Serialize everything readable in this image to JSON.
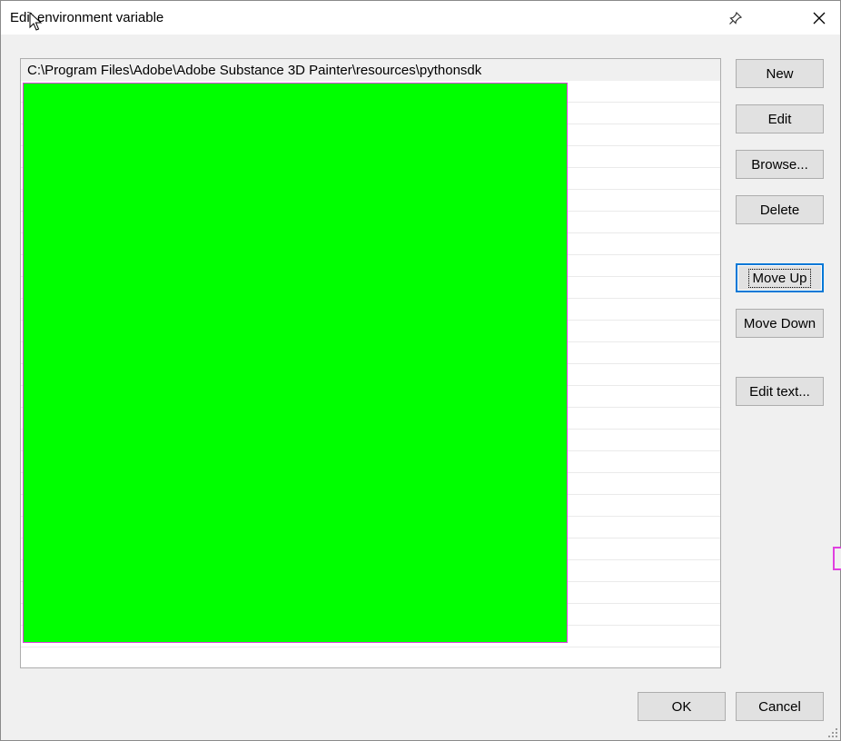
{
  "window": {
    "title": "Edit environment variable"
  },
  "list": {
    "items": [
      "C:\\Program Files\\Adobe\\Adobe Substance 3D Painter\\resources\\pythonsdk"
    ],
    "empty_rows": 26
  },
  "buttons": {
    "new": "New",
    "edit": "Edit",
    "browse": "Browse...",
    "delete": "Delete",
    "move_up": "Move Up",
    "move_down": "Move Down",
    "edit_text": "Edit text...",
    "ok": "OK",
    "cancel": "Cancel"
  },
  "icons": {
    "pin": "pin-icon",
    "close": "close-icon",
    "cursor": "mouse-cursor-icon",
    "resize": "resize-grip-icon"
  },
  "colors": {
    "focus": "#0078d7",
    "overlay_fill": "#00ff00",
    "overlay_border": "#e040e0"
  }
}
